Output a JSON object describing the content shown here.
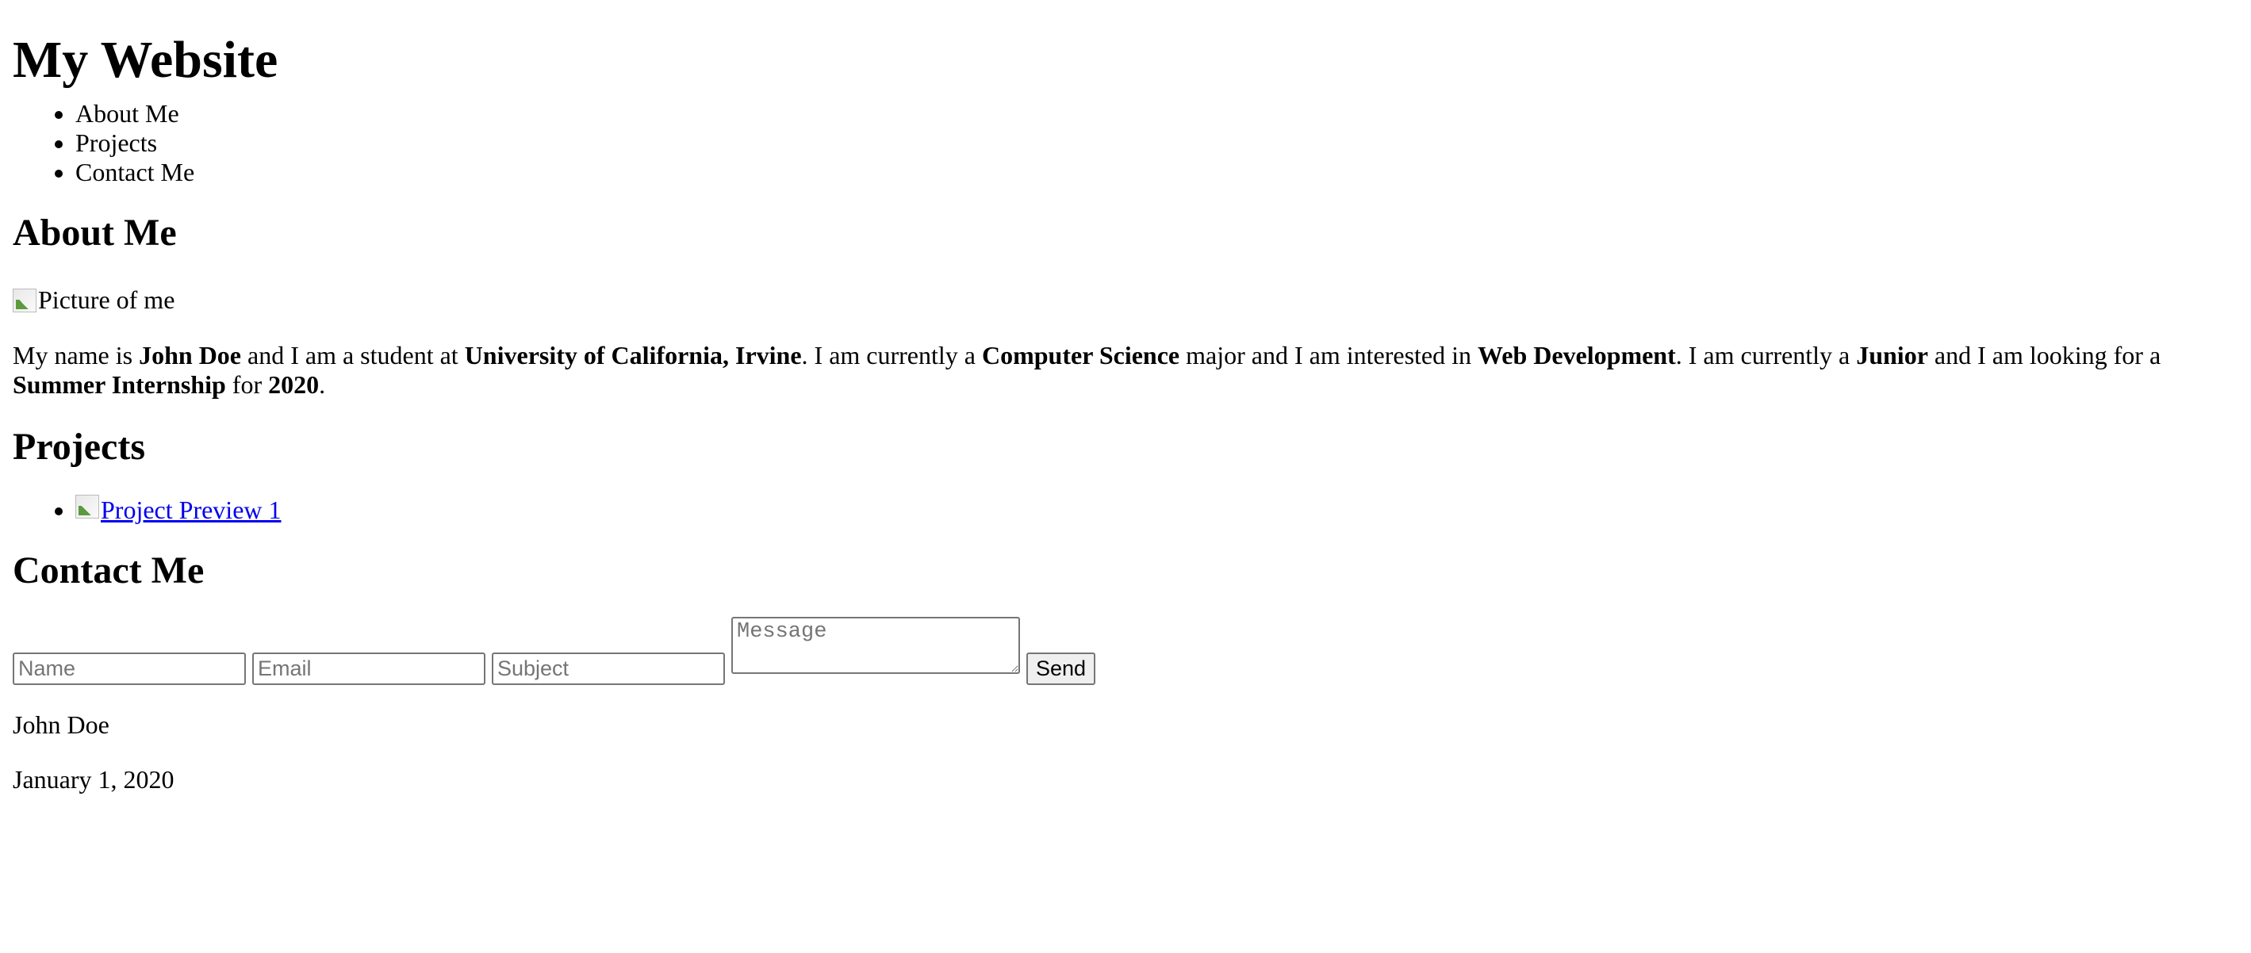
{
  "header": {
    "title": "My Website",
    "nav": [
      "About Me",
      "Projects",
      "Contact Me"
    ]
  },
  "about": {
    "title": "About Me",
    "image_alt": "Picture of me",
    "text": {
      "t1": "My name is ",
      "b1": "John Doe",
      "t2": " and I am a student at ",
      "b2": "University of California, Irvine",
      "t3": ". I am currently a ",
      "b3": "Computer Science",
      "t4": " major and I am interested in ",
      "b4": "Web Development",
      "t5": ". I am currently a ",
      "b5": "Junior",
      "t6": " and I am looking for a ",
      "b6": "Summer Internship",
      "t7": " for ",
      "b7": "2020",
      "t8": "."
    }
  },
  "projects": {
    "title": "Projects",
    "items": [
      {
        "label": "Project Preview 1"
      }
    ]
  },
  "contact": {
    "title": "Contact Me",
    "name_placeholder": "Name",
    "email_placeholder": "Email",
    "subject_placeholder": "Subject",
    "message_placeholder": "Message",
    "send_label": "Send"
  },
  "footer": {
    "name": "John Doe",
    "date": "January 1, 2020"
  }
}
